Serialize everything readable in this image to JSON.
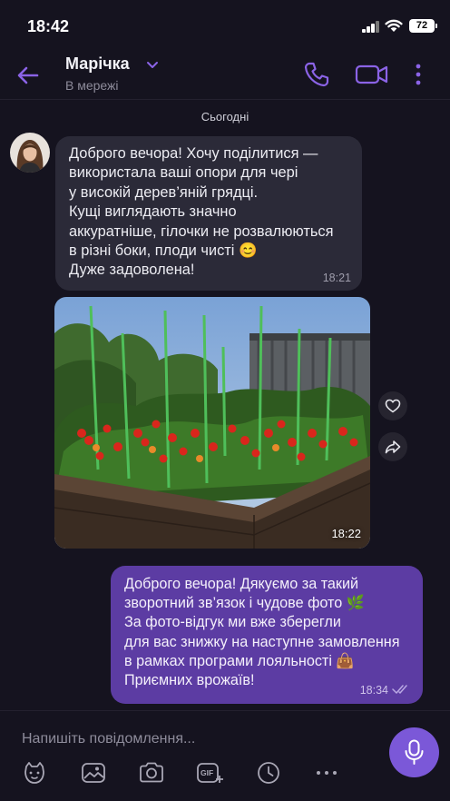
{
  "status_bar": {
    "time": "18:42",
    "battery": "72"
  },
  "header": {
    "contact_name": "Марічка",
    "contact_status": "В мережі"
  },
  "date_separator": "Сьогодні",
  "incoming_message": {
    "lines": [
      "Доброго вечора! Хочу поділитися —",
      "використала ваші опори для чері",
      "у високій дерев’яній грядці.",
      "Кущі виглядають значно",
      "аккуратніше, гілочки не розвалюються",
      "в різні боки, плоди чисті 😊",
      "Дуже задоволена!"
    ],
    "time": "18:21"
  },
  "photo_message": {
    "time": "18:22"
  },
  "outgoing_message": {
    "lines": [
      "Доброго вечора! Дякуємо за такий",
      "зворотний зв’язок і чудове фото 🌿",
      "За фото-відгук ми вже зберегли",
      "для вас знижку на наступне замовлення",
      "в рамках програми лояльності 👜",
      "Приємних врожаїв!"
    ],
    "time": "18:34"
  },
  "composer": {
    "placeholder": "Напишіть повідомлення...",
    "gif_label": "GIF"
  },
  "colors": {
    "background": "#15131f",
    "accent": "#8b63e6",
    "incoming_bubble": "#2b2a38",
    "outgoing_bubble": "#5c3ca3",
    "mic_button": "#7b58d8"
  },
  "icons": [
    "back-arrow-icon",
    "chevron-down-icon",
    "phone-icon",
    "video-camera-icon",
    "more-vertical-icon",
    "heart-icon",
    "share-icon",
    "double-check-icon",
    "sticker-icon",
    "gallery-icon",
    "camera-icon",
    "gif-icon",
    "clock-icon",
    "more-horizontal-icon",
    "microphone-icon"
  ]
}
